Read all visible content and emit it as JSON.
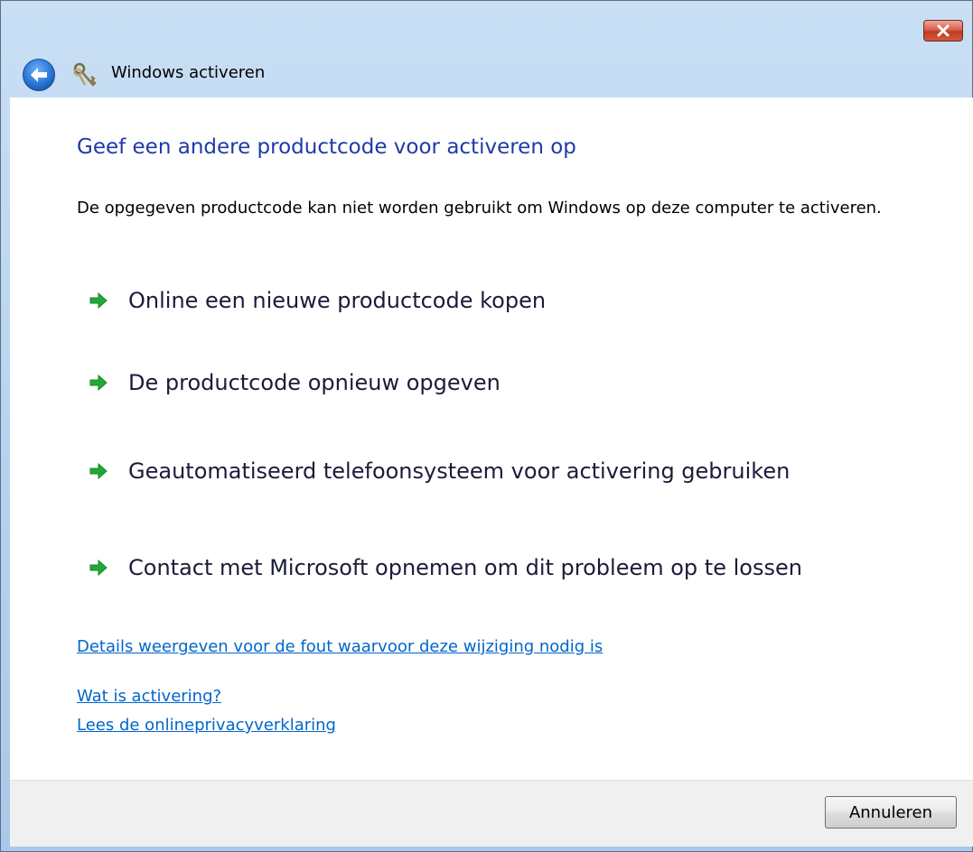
{
  "window": {
    "title": "Windows activeren",
    "close_icon": "close-icon",
    "back_icon": "back-arrow-icon",
    "app_icon": "keys-icon"
  },
  "content": {
    "heading": "Geef een andere productcode voor activeren op",
    "description": "De opgegeven productcode kan niet worden gebruikt om Windows op deze computer te activeren.",
    "options": [
      {
        "label": "Online een nieuwe productcode kopen",
        "icon": "green-arrow-icon"
      },
      {
        "label": "De productcode opnieuw opgeven",
        "icon": "green-arrow-icon"
      },
      {
        "label": "Geautomatiseerd telefoonsysteem voor activering gebruiken",
        "icon": "green-arrow-icon"
      },
      {
        "label": "Contact met Microsoft opnemen om dit probleem op te lossen",
        "icon": "green-arrow-icon"
      }
    ],
    "links": {
      "details": "Details weergeven voor de fout waarvoor deze wijziging nodig is",
      "what_is_activation": "Wat is activering?",
      "privacy": "Lees de onlineprivacyverklaring"
    }
  },
  "footer": {
    "cancel_label": "Annuleren"
  },
  "colors": {
    "heading": "#1e3aa8",
    "link": "#0066cc",
    "arrow": "#22a838"
  }
}
